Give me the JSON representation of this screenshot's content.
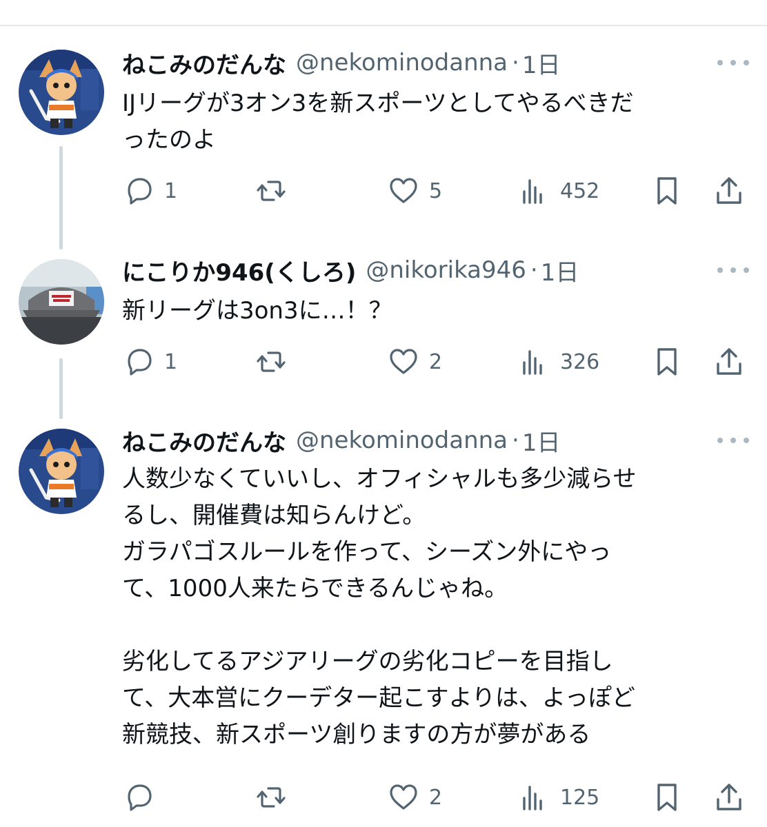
{
  "tweets": [
    {
      "display_name": "ねこみのだんな",
      "handle": "@nekominodanna",
      "separator": "·",
      "time": "1日",
      "text": "IJリーグが3オン3を新スポーツとしてやるべきだ\nったのよ",
      "replies": "1",
      "retweets": "",
      "likes": "5",
      "views": "452",
      "avatar_icon": "mascot-avatar"
    },
    {
      "display_name": "にこりか946(くしろ)",
      "handle": "@nikorika946",
      "separator": "·",
      "time": "1日",
      "text": "新リーグは3on3に…！？",
      "replies": "1",
      "retweets": "",
      "likes": "2",
      "views": "326",
      "avatar_icon": "cap-photo-avatar"
    },
    {
      "display_name": "ねこみのだんな",
      "handle": "@nekominodanna",
      "separator": "·",
      "time": "1日",
      "text": "人数少なくていいし、オフィシャルも多少減らせ\nるし、開催費は知らんけど。\nガラパゴスルールを作って、シーズン外にやっ\nて、1000人来たらできるんじゃね。\n\n劣化してるアジアリーグの劣化コピーを目指し\nて、大本営にクーデター起こすよりは、よっぽど\n新競技、新スポーツ創りますの方が夢がある",
      "replies": "",
      "retweets": "",
      "likes": "2",
      "views": "125",
      "avatar_icon": "mascot-avatar"
    }
  ],
  "colors": {
    "text": "#0f1419",
    "muted": "#536471",
    "thread_line": "#cfd9de",
    "divider": "#e7e9ea"
  }
}
